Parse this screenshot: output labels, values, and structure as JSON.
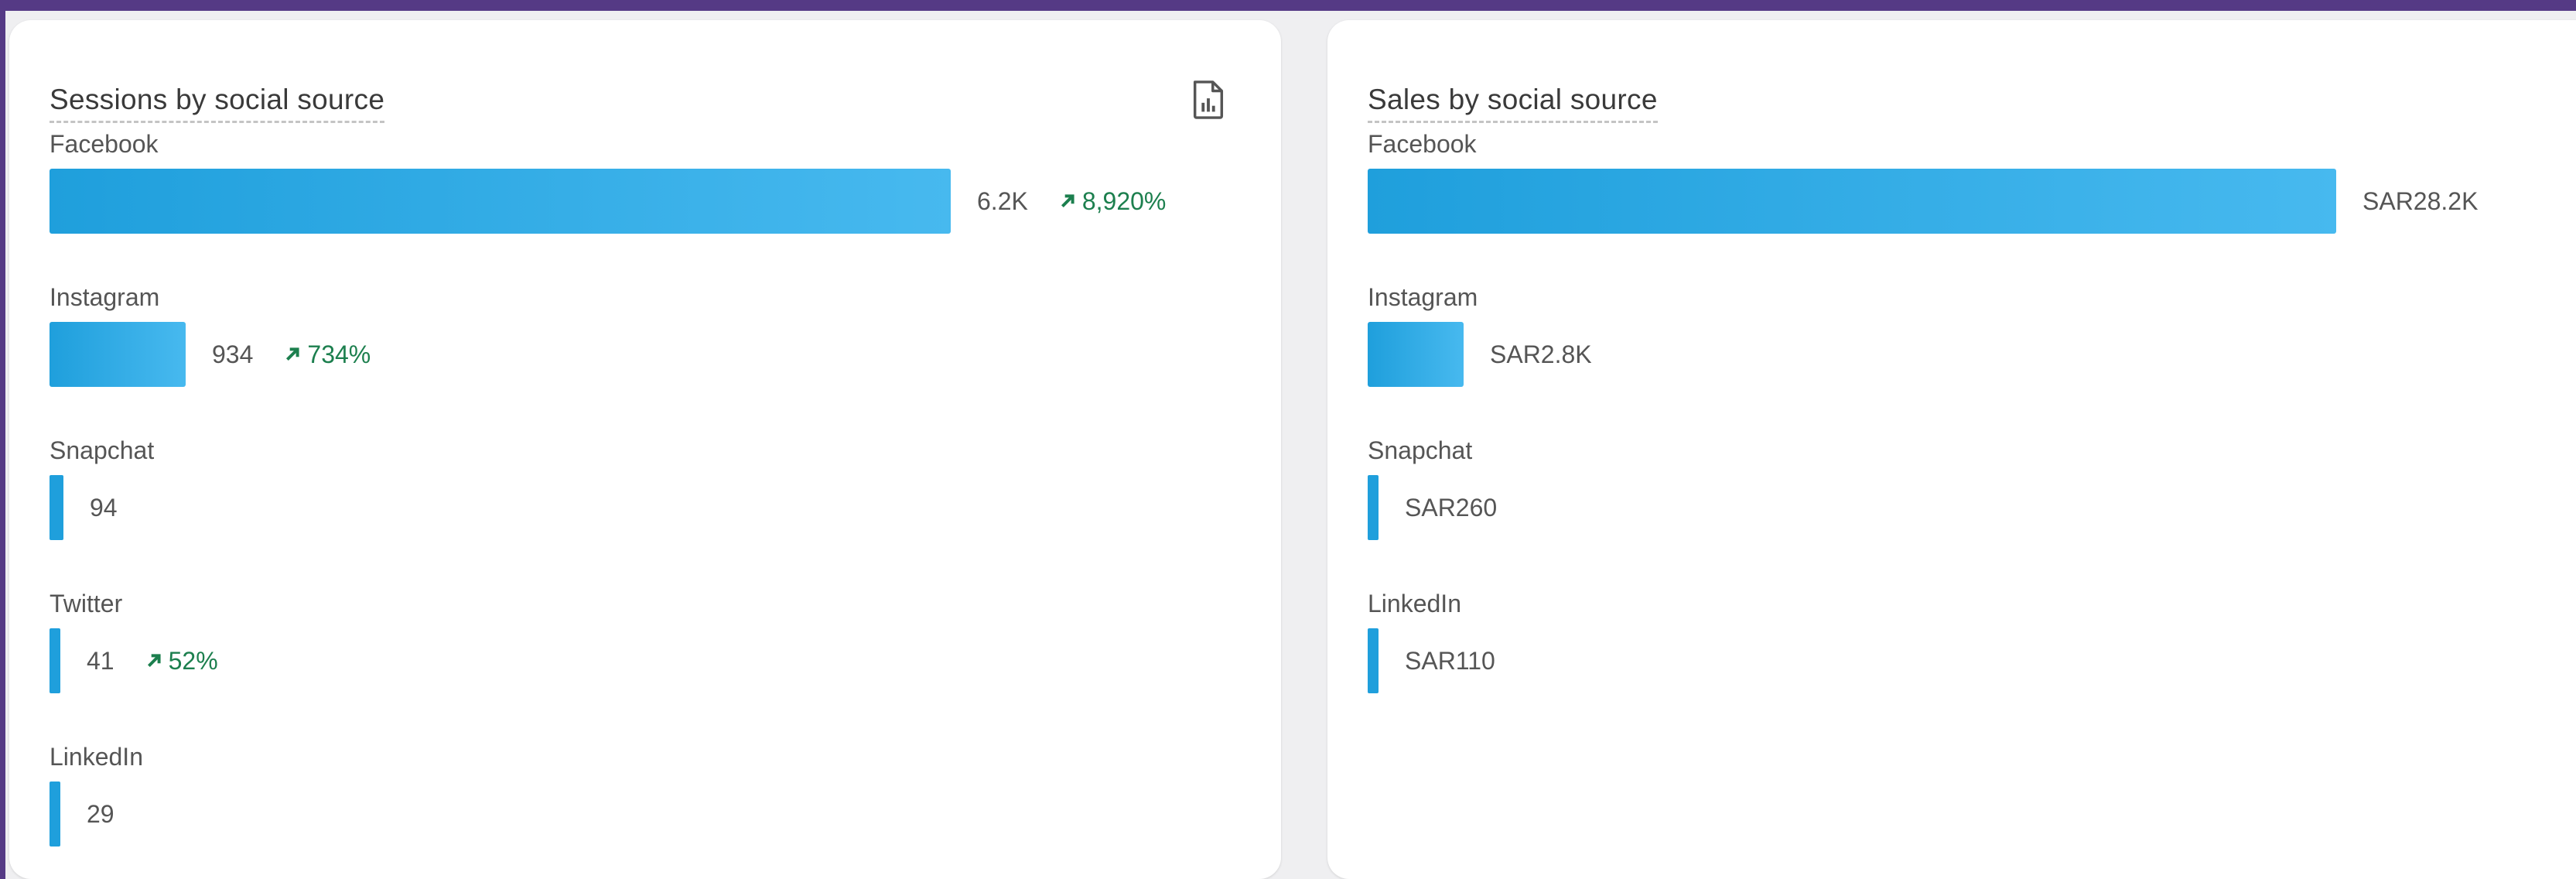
{
  "panels": [
    {
      "title": "Sessions by social source",
      "rows": [
        {
          "label": "Facebook",
          "value": "6.2K",
          "change": "8,920%",
          "raw": 6200
        },
        {
          "label": "Instagram",
          "value": "934",
          "change": "734%",
          "raw": 934
        },
        {
          "label": "Snapchat",
          "value": "94",
          "change": "",
          "raw": 94
        },
        {
          "label": "Twitter",
          "value": "41",
          "change": "52%",
          "raw": 41
        },
        {
          "label": "LinkedIn",
          "value": "29",
          "change": "",
          "raw": 29
        }
      ]
    },
    {
      "title": "Sales by social source",
      "rows": [
        {
          "label": "Facebook",
          "value": "SAR28.2K",
          "change": "",
          "raw": 28200
        },
        {
          "label": "Instagram",
          "value": "SAR2.8K",
          "change": "",
          "raw": 2800
        },
        {
          "label": "Snapchat",
          "value": "SAR260",
          "change": "",
          "raw": 260
        },
        {
          "label": "LinkedIn",
          "value": "SAR110",
          "change": "",
          "raw": 110
        }
      ]
    }
  ],
  "colors": {
    "bar": "#1f9fdc",
    "trend_up": "#1c7f4e",
    "frame": "#553a85"
  },
  "icons": {
    "export": "export-report-icon",
    "trend": "trend-up-arrow-icon"
  }
}
